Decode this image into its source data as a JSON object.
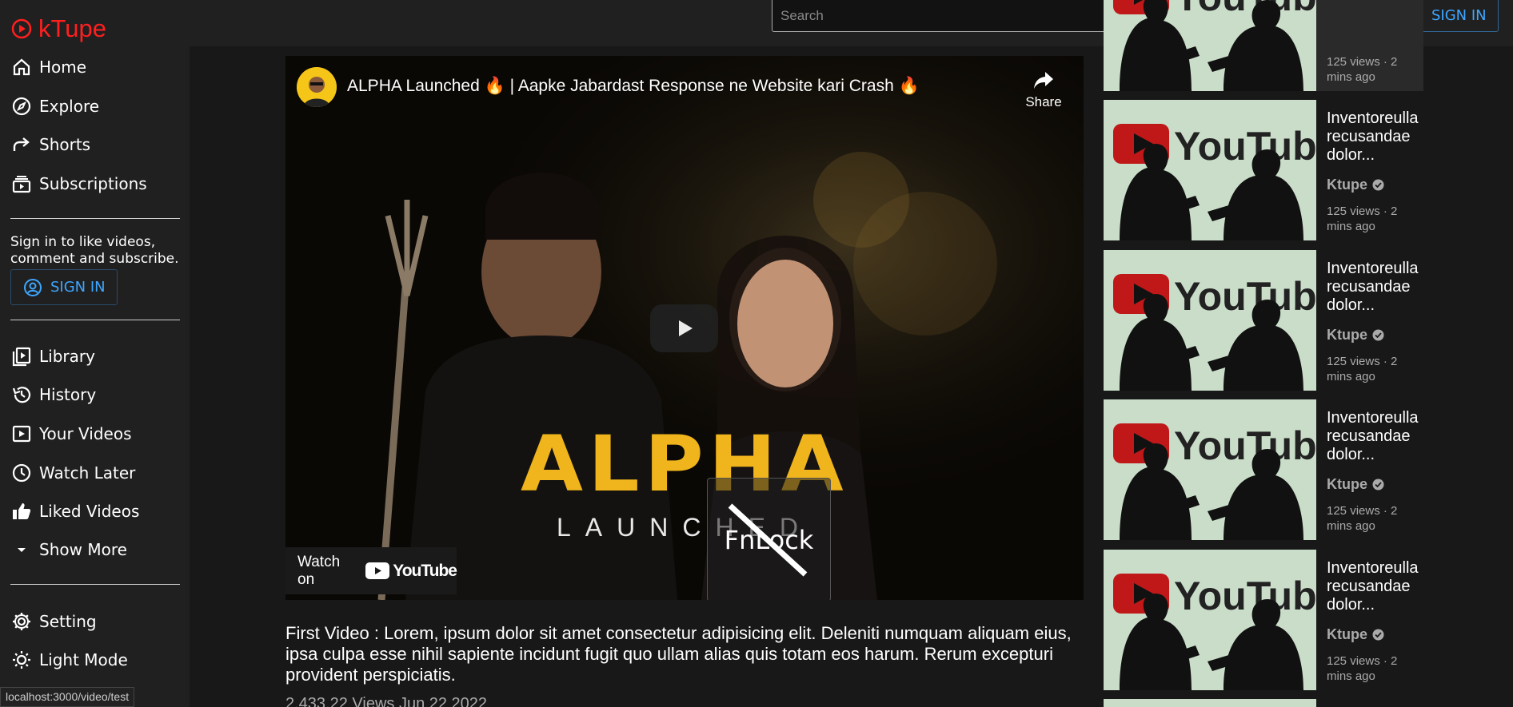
{
  "app": {
    "logo_text": "kTupe"
  },
  "sidebar": {
    "items_top": [
      {
        "label": "Home",
        "icon": "home-icon"
      },
      {
        "label": "Explore",
        "icon": "compass-icon"
      },
      {
        "label": "Shorts",
        "icon": "share-arrow-icon"
      },
      {
        "label": "Subscriptions",
        "icon": "subscriptions-icon"
      }
    ],
    "signin_note": "Sign in to like videos, comment and subscribe.",
    "signin_label": "SIGN IN",
    "items_mid": [
      {
        "label": "Library",
        "icon": "library-icon"
      },
      {
        "label": "History",
        "icon": "history-icon"
      },
      {
        "label": "Your Videos",
        "icon": "video-icon"
      },
      {
        "label": "Watch Later",
        "icon": "clock-icon"
      },
      {
        "label": "Liked Videos",
        "icon": "thumbs-up-icon"
      },
      {
        "label": "Show More",
        "icon": "caret-down-icon"
      }
    ],
    "items_bottom": [
      {
        "label": "Setting",
        "icon": "gear-icon"
      },
      {
        "label": "Light Mode",
        "icon": "sun-icon"
      }
    ]
  },
  "header": {
    "search_placeholder": "Search",
    "signin_label": "SIGN IN"
  },
  "player": {
    "title": "ALPHA Launched 🔥 | Aapke Jabardast Response ne Website kari Crash 🔥",
    "share_label": "Share",
    "thumbnail_title": "ALPHA",
    "thumbnail_subtitle": "LAUNCHED",
    "watch_on_label": "Watch on",
    "youtube_label": "YouTube",
    "overlay_label": "FnLock"
  },
  "video": {
    "description": "First Video : Lorem, ipsum dolor sit amet consectetur adipisicing elit. Deleniti numquam aliquam eius, ipsa culpa esse nihil sapiente incidunt fugit quo ullam alias quis totam eos harum. Rerum excepturi provident perspiciatis.",
    "meta": "2,433,22 Views Jun 22 2022"
  },
  "recommendations": [
    {
      "title": "",
      "channel": "",
      "stats": "125 views · 2 mins ago"
    },
    {
      "title": "Inventoreulla recusandae dolor...",
      "channel": "Ktupe",
      "stats": "125 views · 2 mins ago"
    },
    {
      "title": "Inventoreulla recusandae dolor...",
      "channel": "Ktupe",
      "stats": "125 views · 2 mins ago"
    },
    {
      "title": "Inventoreulla recusandae dolor...",
      "channel": "Ktupe",
      "stats": "125 views · 2 mins ago"
    },
    {
      "title": "Inventoreulla recusandae dolor...",
      "channel": "Ktupe",
      "stats": "125 views · 2 mins ago"
    }
  ],
  "thumb_text": "YouTube",
  "status_url": "localhost:3000/video/test",
  "colors": {
    "brand": "#ff1f1f",
    "accent": "#3ea6ff",
    "background": "#181818"
  }
}
